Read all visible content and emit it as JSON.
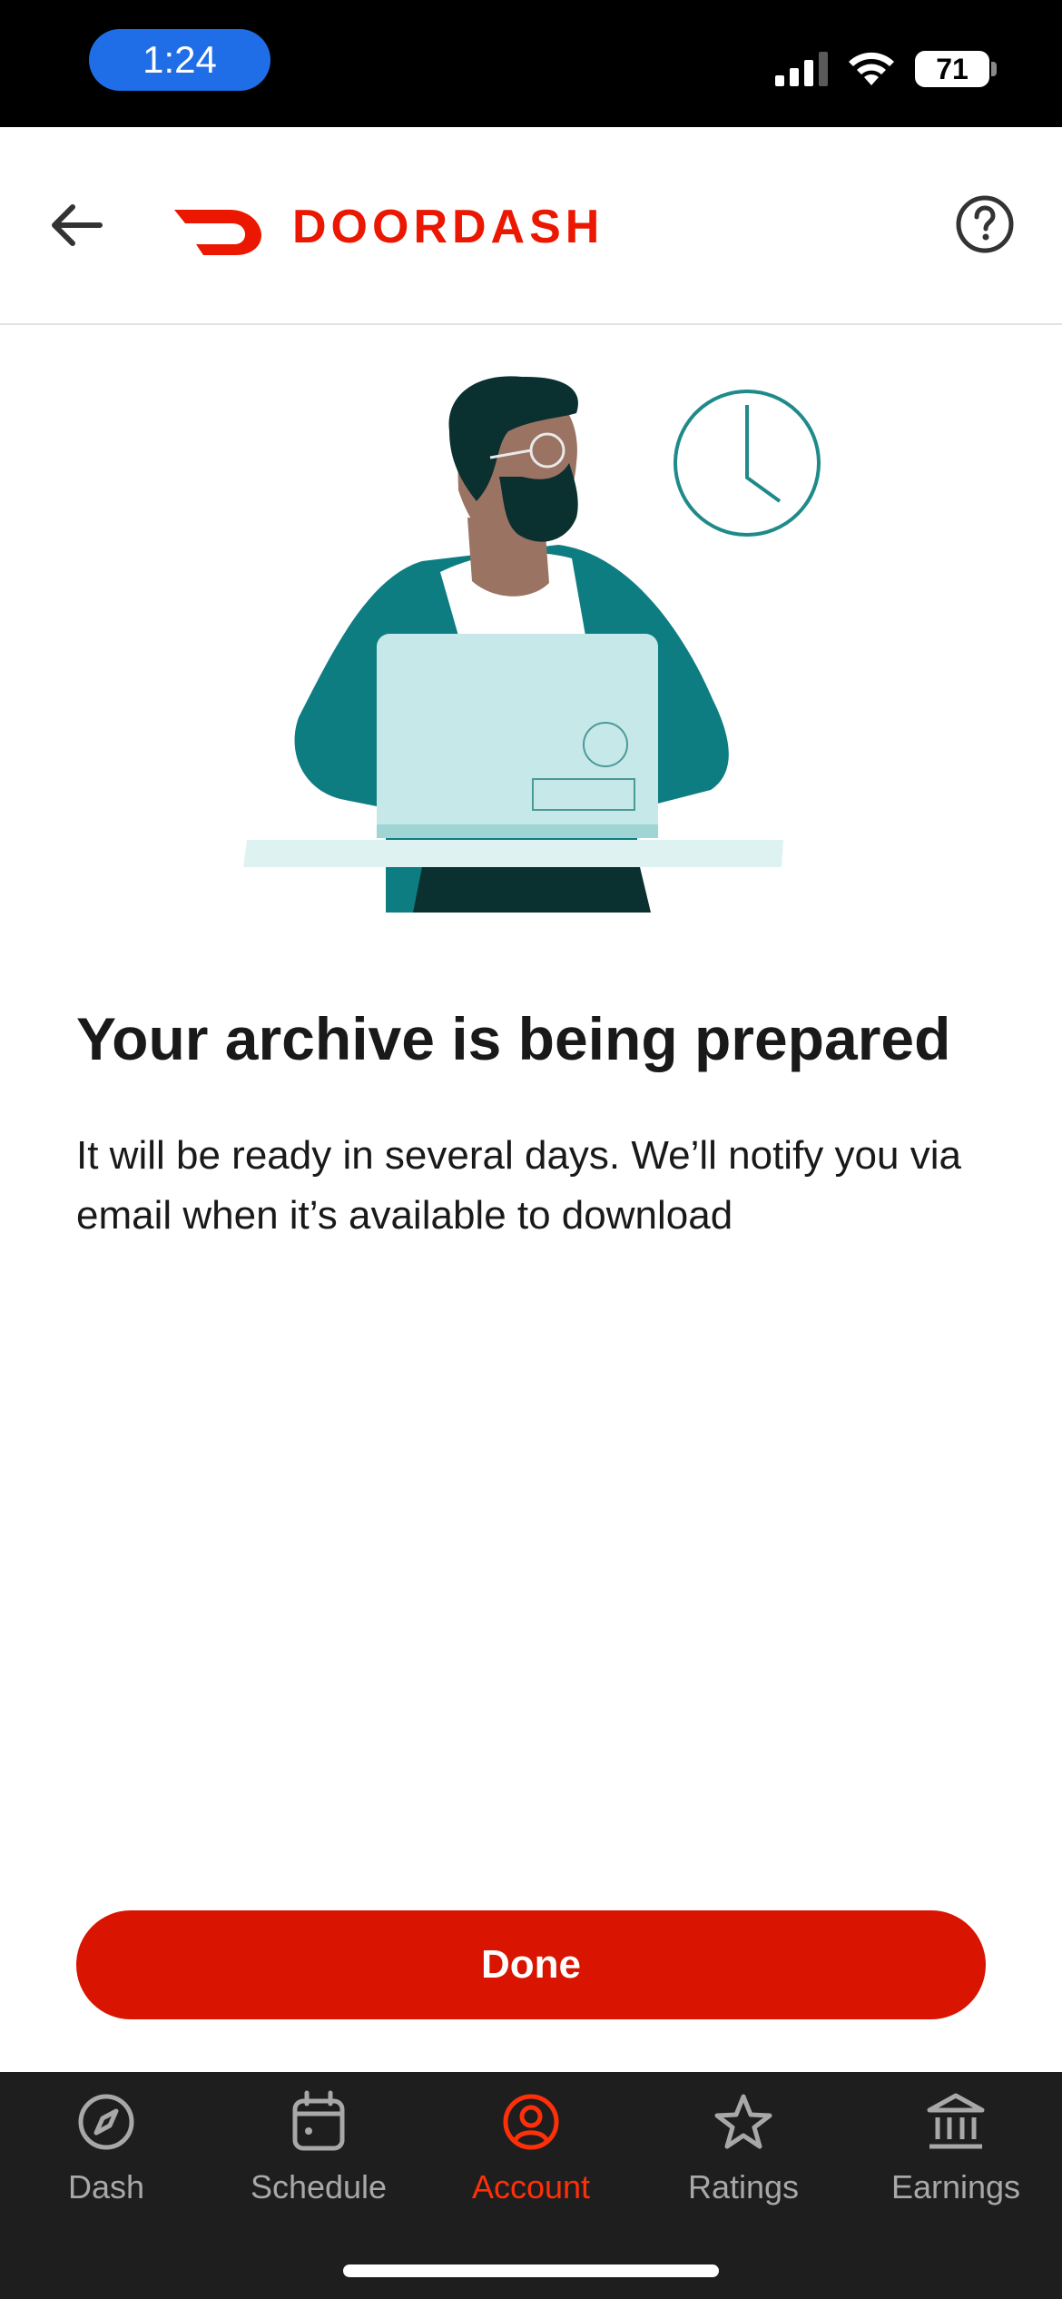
{
  "status_bar": {
    "time": "1:24",
    "battery": "71"
  },
  "header": {
    "brand": "DOORDASH",
    "back_icon": "arrow-left-icon",
    "help_icon": "question-circle-icon"
  },
  "content": {
    "title": "Your archive is being prepared",
    "body": "It will be ready in several days. We’ll notify you via email when it’s available to download"
  },
  "actions": {
    "done_label": "Done"
  },
  "bottom_nav": {
    "items": [
      {
        "label": "Dash",
        "icon": "compass-icon"
      },
      {
        "label": "Schedule",
        "icon": "calendar-icon"
      },
      {
        "label": "Account",
        "icon": "user-circle-icon",
        "active": true
      },
      {
        "label": "Ratings",
        "icon": "star-icon"
      },
      {
        "label": "Earnings",
        "icon": "bank-icon"
      }
    ]
  },
  "colors": {
    "brand": "#eb1700",
    "button": "#d91400",
    "nav_active": "#ff3008",
    "nav_bg": "#1e1e1e"
  }
}
